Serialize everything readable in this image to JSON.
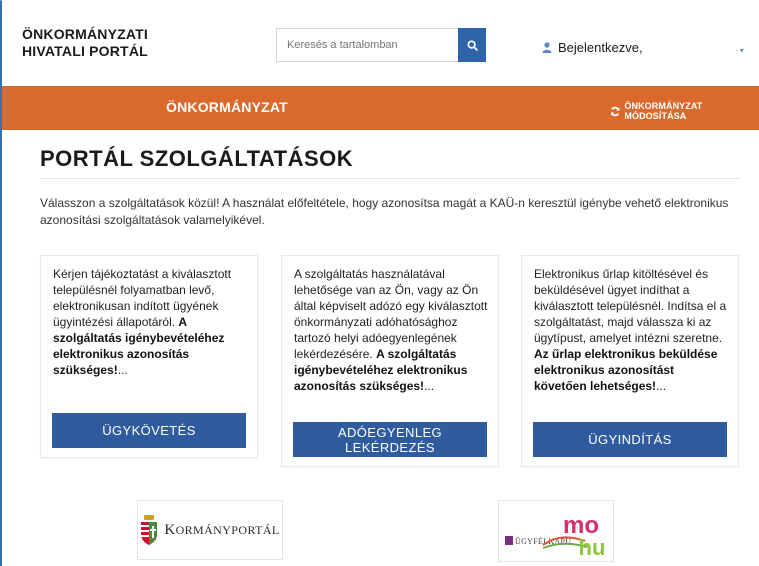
{
  "header": {
    "brand_line1": "ÖNKORMÁNYZATI",
    "brand_line2": "HIVATALI PORTÁL",
    "search_placeholder": "Keresés a tartalomban",
    "user_label": "Bejelentkezve,"
  },
  "topbar": {
    "title": "ÖNKORMÁNYZAT",
    "modify_label": "ÖNKORMÁNYZAT MÓDOSÍTÁSA"
  },
  "main": {
    "title": "PORTÁL SZOLGÁLTATÁSOK",
    "intro": "Válasszon a szolgáltatások közül! A használat előfeltétele, hogy azonosítsa magát a KAÜ-n keresztül igénybe vehető elektronikus azonosítási szolgáltatások valamelyikével."
  },
  "cards": [
    {
      "text": "Kérjen tájékoztatást a kiválasztott településnél folyamatban levő, elektronikusan indított ügyének ügyintézési állapotáról.",
      "bold": "A szolgáltatás igénybevételéhez elektronikus azonosítás szükséges!",
      "ellipsis": "...",
      "button": "ÜGYKÖVETÉS"
    },
    {
      "text": "A szolgáltatás használatával lehetősége van az Ön, vagy az Ön által képviselt adózó egy kiválasztott önkormányzati adóhatósághoz tartozó helyi adóegyenlegének lekérdezésére.",
      "bold": "A szolgáltatás igénybevételéhez elektronikus azonosítás szükséges!",
      "ellipsis": "...",
      "button": "ADÓEGYENLEG LEKÉRDEZÉS"
    },
    {
      "text": "Elektronikus űrlap kitöltésével és beküldésével ügyet indíthat a kiválasztott településnél. Indítsa el a szolgáltatást, majd válassza ki az ügytípust, amelyet intézni szeretne.",
      "bold": "Az űrlap elektronikus beküldése elektronikus azonosítást követően lehetséges!",
      "ellipsis": "...",
      "button": "ÜGYINDÍTÁS"
    }
  ],
  "logos": {
    "kormanyportal_first": "K",
    "kormanyportal_rest": "ORMÁNYPORTÁL",
    "ugyfelkapu_label": "ÜGYFÉLKAPU",
    "mo": "mo",
    "hu": "hu"
  },
  "colors": {
    "accent_orange": "#d96a2c",
    "button_blue": "#2f5c9e",
    "search_blue": "#2f64a8"
  },
  "icons": {
    "search": "search-icon",
    "user": "user-icon",
    "refresh": "refresh-icon",
    "dropdown": "caret-down-icon"
  }
}
